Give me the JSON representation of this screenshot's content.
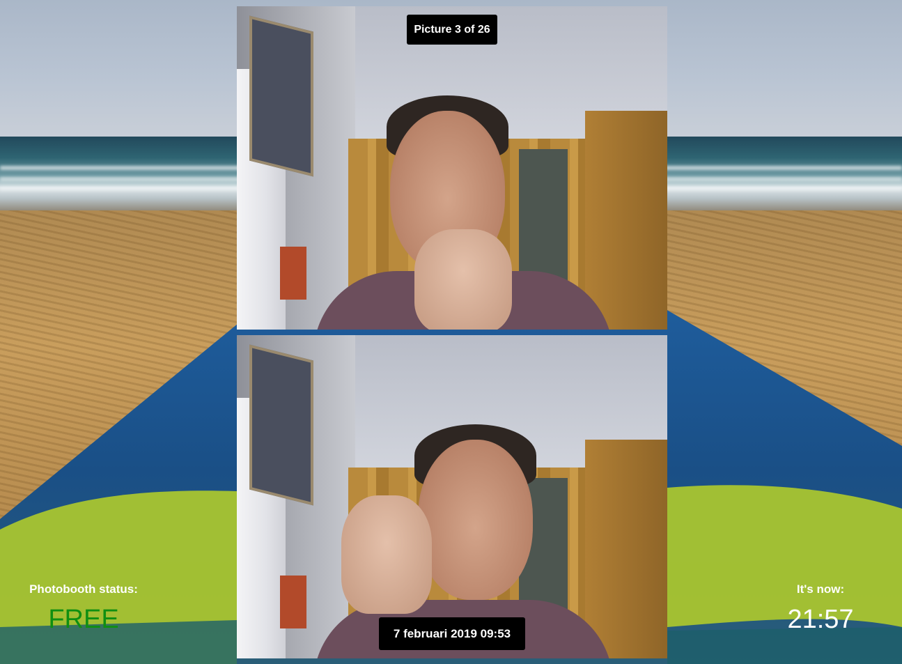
{
  "slideshow": {
    "counter": "Picture 3 of 26",
    "date": "7 februari 2019 09:53"
  },
  "status": {
    "label": "Photobooth status:",
    "value": "FREE",
    "value_color": "#0f8f12"
  },
  "clock": {
    "label": "It's now:",
    "time": "21:57"
  },
  "background": {
    "scene": "beach-with-towel"
  }
}
